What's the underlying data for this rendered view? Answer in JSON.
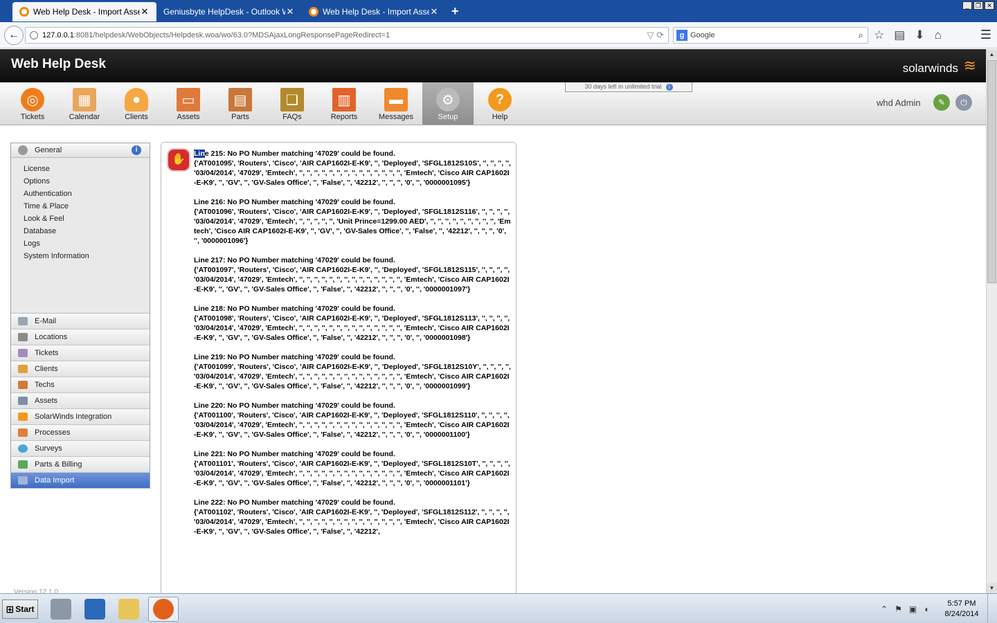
{
  "browser": {
    "tabs": [
      {
        "label": "Web Help Desk - Import Assets",
        "active": true
      },
      {
        "label": "Geniusbyte HelpDesk - Outlook W...",
        "active": false
      },
      {
        "label": "Web Help Desk - Import Assets",
        "active": false
      }
    ],
    "new_tab": "+",
    "url_host": "127.0.0.1",
    "url_path": ":8081/helpdesk/WebObjects/Helpdesk.woa/wo/63.0?MDSAjaxLongResponsePageRedirect=1",
    "search_placeholder": "Google"
  },
  "app": {
    "title": "Web Help Desk",
    "brand": "solarwinds",
    "trial_notice": "30 days left in unlimited trial",
    "user": "whd Admin"
  },
  "toolbar": [
    {
      "label": "Tickets",
      "icon": "lifebuoy-icon",
      "color": "#f07c1a"
    },
    {
      "label": "Calendar",
      "icon": "calendar-icon",
      "color": "#e9a65b"
    },
    {
      "label": "Clients",
      "icon": "person-icon",
      "color": "#f5a742"
    },
    {
      "label": "Assets",
      "icon": "monitor-icon",
      "color": "#e07a3a"
    },
    {
      "label": "Parts",
      "icon": "printer-icon",
      "color": "#c9773a"
    },
    {
      "label": "FAQs",
      "icon": "book-icon",
      "color": "#b3892c"
    },
    {
      "label": "Reports",
      "icon": "chart-icon",
      "color": "#e0642a"
    },
    {
      "label": "Messages",
      "icon": "message-icon",
      "color": "#f0892c"
    },
    {
      "label": "Setup",
      "icon": "gear-icon",
      "color": "#bbbbbb",
      "active": true
    },
    {
      "label": "Help",
      "icon": "question-icon",
      "color": "#f39a1d"
    }
  ],
  "sidebar": {
    "general": {
      "label": "General"
    },
    "general_items": [
      "License",
      "Options",
      "Authentication",
      "Time & Place",
      "Look & Feel",
      "Database",
      "Logs",
      "System Information"
    ],
    "sections": [
      {
        "label": "E-Mail",
        "color": "#9aa6b3"
      },
      {
        "label": "Locations",
        "color": "#8a8a8a"
      },
      {
        "label": "Tickets",
        "color": "#a48ac0"
      },
      {
        "label": "Clients",
        "color": "#e0a040"
      },
      {
        "label": "Techs",
        "color": "#d07a3a"
      },
      {
        "label": "Assets",
        "color": "#7d8fa8"
      },
      {
        "label": "SolarWinds Integration",
        "color": "#f39a1d"
      },
      {
        "label": "Processes",
        "color": "#e0803a"
      },
      {
        "label": "Surveys",
        "color": "#4aa6d8"
      },
      {
        "label": "Parts & Billing",
        "color": "#5ea85a"
      },
      {
        "label": "Data Import",
        "color": "#a0b4d8",
        "active": true
      }
    ]
  },
  "messages": [
    {
      "head_hl": "Lin",
      "head": "e 215: No PO Number matching '47029' could be found.",
      "body": "{'AT001095', 'Routers', 'Cisco', 'AIR CAP1602I-E-K9', '', 'Deployed', 'SFGL1812S10S', '', '', '', '', '03/04/2014', '47029', 'Emtech', '', '', '', '', '', '', '', '', '', '', '', '', '', '', 'Emtech', 'Cisco AIR CAP1602I-E-K9', '', 'GV', '', 'GV-Sales Office', '', 'False', '', '42212', '', '', '', '0', '', '0000001095'}"
    },
    {
      "head_hl": "",
      "head": "Line 216: No PO Number matching '47029' could be found.",
      "body": "{'AT001096', 'Routers', 'Cisco', 'AIR CAP1602I-E-K9', '', 'Deployed', 'SFGL1812S116', '', '', '', '', '03/04/2014', '47029', 'Emtech', '', '', '', '', '', 'Unit Prince=1299.00 AED', '', '', '', '', '', '', '', '', '', 'Emtech', 'Cisco AIR CAP1602I-E-K9', '', 'GV', '', 'GV-Sales Office', '', 'False', '', '42212', '', '', '', '0', '', '0000001096'}"
    },
    {
      "head_hl": "",
      "head": "Line 217: No PO Number matching '47029' could be found.",
      "body": "{'AT001097', 'Routers', 'Cisco', 'AIR CAP1602I-E-K9', '', 'Deployed', 'SFGL1812S115', '', '', '', '', '03/04/2014', '47029', 'Emtech', '', '', '', '', '', '', '', '', '', '', '', '', '', '', 'Emtech', 'Cisco AIR CAP1602I-E-K9', '', 'GV', '', 'GV-Sales Office', '', 'False', '', '42212', '', '', '', '0', '', '0000001097'}"
    },
    {
      "head_hl": "",
      "head": "Line 218: No PO Number matching '47029' could be found.",
      "body": "{'AT001098', 'Routers', 'Cisco', 'AIR CAP1602I-E-K9', '', 'Deployed', 'SFGL1812S113', '', '', '', '', '03/04/2014', '47029', 'Emtech', '', '', '', '', '', '', '', '', '', '', '', '', '', '', 'Emtech', 'Cisco AIR CAP1602I-E-K9', '', 'GV', '', 'GV-Sales Office', '', 'False', '', '42212', '', '', '', '0', '', '0000001098'}"
    },
    {
      "head_hl": "",
      "head": "Line 219: No PO Number matching '47029' could be found.",
      "body": "{'AT001099', 'Routers', 'Cisco', 'AIR CAP1602I-E-K9', '', 'Deployed', 'SFGL1812S10Y', '', '', '', '', '03/04/2014', '47029', 'Emtech', '', '', '', '', '', '', '', '', '', '', '', '', '', '', 'Emtech', 'Cisco AIR CAP1602I-E-K9', '', 'GV', '', 'GV-Sales Office', '', 'False', '', '42212', '', '', '', '0', '', '0000001099'}"
    },
    {
      "head_hl": "",
      "head": "Line 220: No PO Number matching '47029' could be found.",
      "body": "{'AT001100', 'Routers', 'Cisco', 'AIR CAP1602I-E-K9', '', 'Deployed', 'SFGL1812S110', '', '', '', '', '03/04/2014', '47029', 'Emtech', '', '', '', '', '', '', '', '', '', '', '', '', '', '', 'Emtech', 'Cisco AIR CAP1602I-E-K9', '', 'GV', '', 'GV-Sales Office', '', 'False', '', '42212', '', '', '', '0', '', '0000001100'}"
    },
    {
      "head_hl": "",
      "head": "Line 221: No PO Number matching '47029' could be found.",
      "body": "{'AT001101', 'Routers', 'Cisco', 'AIR CAP1602I-E-K9', '', 'Deployed', 'SFGL1812S10T', '', '', '', '', '03/04/2014', '47029', 'Emtech', '', '', '', '', '', '', '', '', '', '', '', '', '', '', 'Emtech', 'Cisco AIR CAP1602I-E-K9', '', 'GV', '', 'GV-Sales Office', '', 'False', '', '42212', '', '', '', '0', '', '0000001101'}"
    },
    {
      "head_hl": "",
      "head": "Line 222: No PO Number matching '47029' could be found.",
      "body": "{'AT001102', 'Routers', 'Cisco', 'AIR CAP1602I-E-K9', '', 'Deployed', 'SFGL1812S112', '', '', '', '', '03/04/2014', '47029', 'Emtech', '', '', '', '', '', '', '', '', '', '', '', '', '', '', 'Emtech', 'Cisco AIR CAP1602I-E-K9', '', 'GV', '', 'GV-Sales Office', '', 'False', '', '42212',"
    }
  ],
  "footer": {
    "version": "Version 12.1.0"
  },
  "taskbar": {
    "start_label": "Start",
    "time": "5:57 PM",
    "date": "8/24/2014"
  }
}
